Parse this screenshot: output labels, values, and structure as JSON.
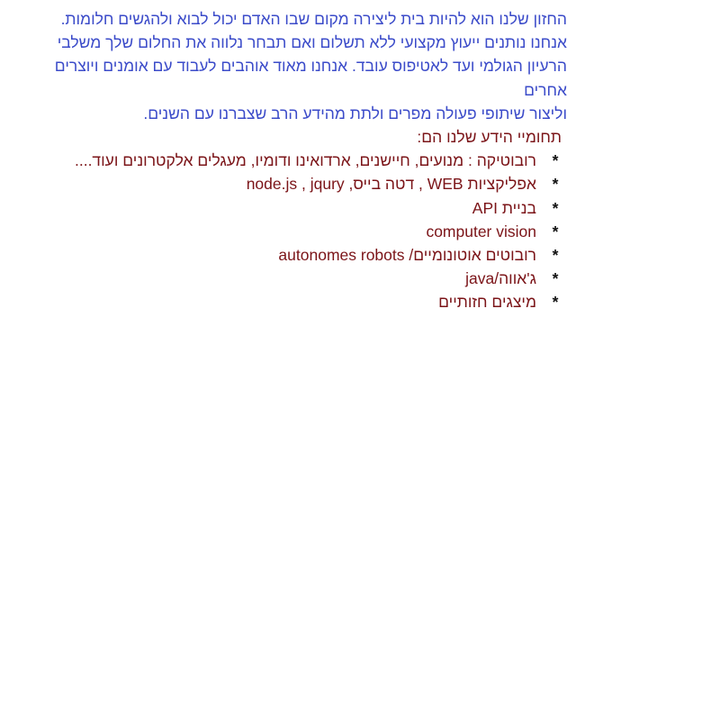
{
  "intro": {
    "lines": [
      "החזון שלנו הוא להיות בית ליצירה מקום שבו האדם יכול לבוא ולהגשים חלומות.",
      "אנחנו נותנים ייעוץ מקצועי ללא תשלום ואם תבחר נלווה את החלום שלך משלבי",
      "הרעיון הגולמי ועד לאטיפוס עובד. אנחנו מאוד אוהבים לעבוד עם אומנים ויוצרים",
      "אחרים",
      "וליצור שיתופי פעולה מפרים ולתת מהידע הרב שצברנו עם השנים."
    ]
  },
  "knowledge": {
    "heading": "תחומיי הידע שלנו הם:",
    "bullet_symbol": "*",
    "items": [
      "רובוטיקה : מנועים, חיישנים, ארדואינו ודומיו, מעגלים אלקטרונים ועוד....",
      "אפליקציות WEB , דטה בייס, node.js , jqury",
      "בניית API",
      "computer vision",
      "רובוטים אוטונומיים/ autonomes robots",
      "ג'אווה/java",
      "מיצגים חזותיים"
    ]
  },
  "colors": {
    "intro_text": "#3b4bc9",
    "list_text": "#7b1418",
    "bullet": "#111111",
    "background": "#ffffff"
  }
}
